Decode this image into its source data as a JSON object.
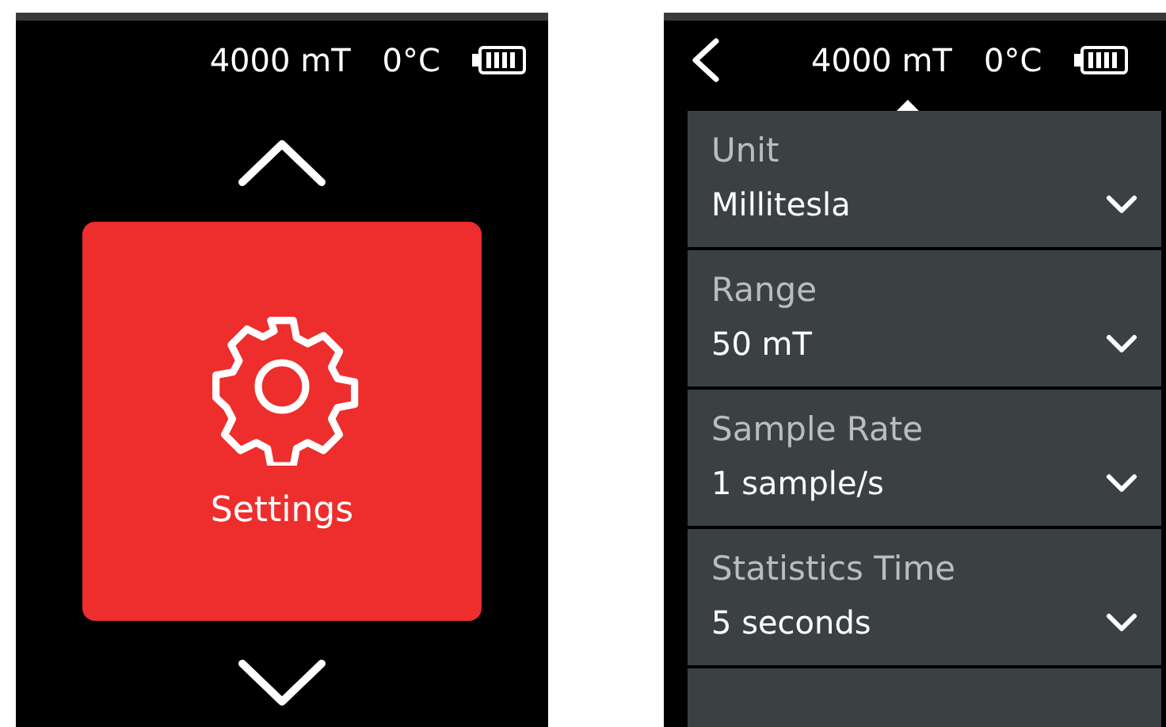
{
  "home_screen": {
    "status_bar": {
      "field": "4000 mT",
      "temperature": "0°C"
    },
    "tile": {
      "label": "Settings"
    }
  },
  "settings_screen": {
    "status_bar": {
      "field": "4000 mT",
      "temperature": "0°C"
    },
    "settings": [
      {
        "label": "Unit",
        "value": "Millitesla"
      },
      {
        "label": "Range",
        "value": "50 mT"
      },
      {
        "label": "Sample Rate",
        "value": "1 sample/s"
      },
      {
        "label": "Statistics Time",
        "value": "5 seconds"
      }
    ]
  }
}
